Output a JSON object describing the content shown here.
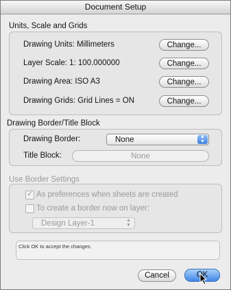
{
  "window": {
    "title": "Document Setup"
  },
  "units_group": {
    "label": "Units, Scale and Grids",
    "rows": [
      {
        "label": "Drawing Units:  Millimeters",
        "button": "Change..."
      },
      {
        "label": "Layer Scale:  1: 100.000000",
        "button": "Change..."
      },
      {
        "label": "Drawing Area:  ISO A3",
        "button": "Change..."
      },
      {
        "label": "Drawing Grids:  Grid Lines = ON",
        "button": "Change..."
      }
    ]
  },
  "border_group": {
    "label": "Drawing Border/Title Block",
    "drawing_border_label": "Drawing Border:",
    "drawing_border_value": "None",
    "title_block_label": "Title Block:",
    "title_block_value": "None"
  },
  "use_border_group": {
    "label": "Use Border Settings",
    "option1_label": "As preferences when sheets are created",
    "option1_checked": true,
    "option2_label": "To create a border now on layer:",
    "option2_checked": false,
    "layer_value": "Design Layer-1"
  },
  "status": {
    "text": "Click OK to accept the changes."
  },
  "footer": {
    "cancel_label": "Cancel",
    "ok_label": "OK"
  }
}
